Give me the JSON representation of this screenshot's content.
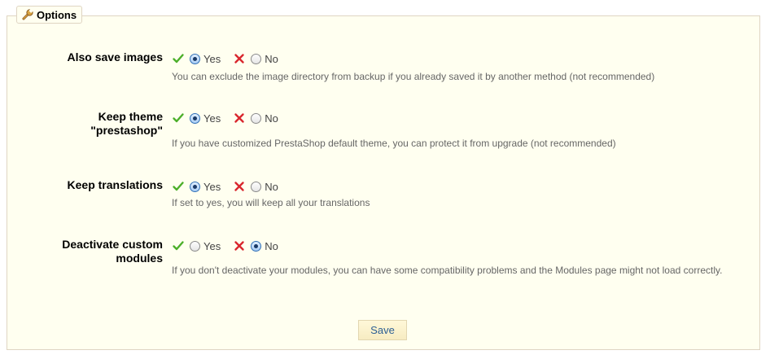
{
  "legend": {
    "title": "Options",
    "icon": "wrench-icon"
  },
  "options": [
    {
      "label_lines": [
        "Also save images"
      ],
      "yes_label": "Yes",
      "no_label": "No",
      "selected": "yes",
      "description": "You can exclude the image directory from backup if you already saved it by another method (not recommended)"
    },
    {
      "label_lines": [
        "Keep theme",
        "\"prestashop\""
      ],
      "yes_label": "Yes",
      "no_label": "No",
      "selected": "yes",
      "description": "If you have customized PrestaShop default theme, you can protect it from upgrade (not recommended)"
    },
    {
      "label_lines": [
        "Keep translations"
      ],
      "yes_label": "Yes",
      "no_label": "No",
      "selected": "yes",
      "description": "If set to yes, you will keep all your translations"
    },
    {
      "label_lines": [
        "Deactivate custom",
        "modules"
      ],
      "yes_label": "Yes",
      "no_label": "No",
      "selected": "no",
      "description": "If you don't deactivate your modules, you can have some compatibility problems and the Modules page might not load correctly."
    }
  ],
  "save_button": {
    "label": "Save"
  },
  "colors": {
    "panel_background": "#fffff0",
    "panel_border": "#dfd5c3",
    "check_green": "#4caf2a",
    "cross_red": "#d9272e",
    "button_text": "#2c5f94"
  }
}
